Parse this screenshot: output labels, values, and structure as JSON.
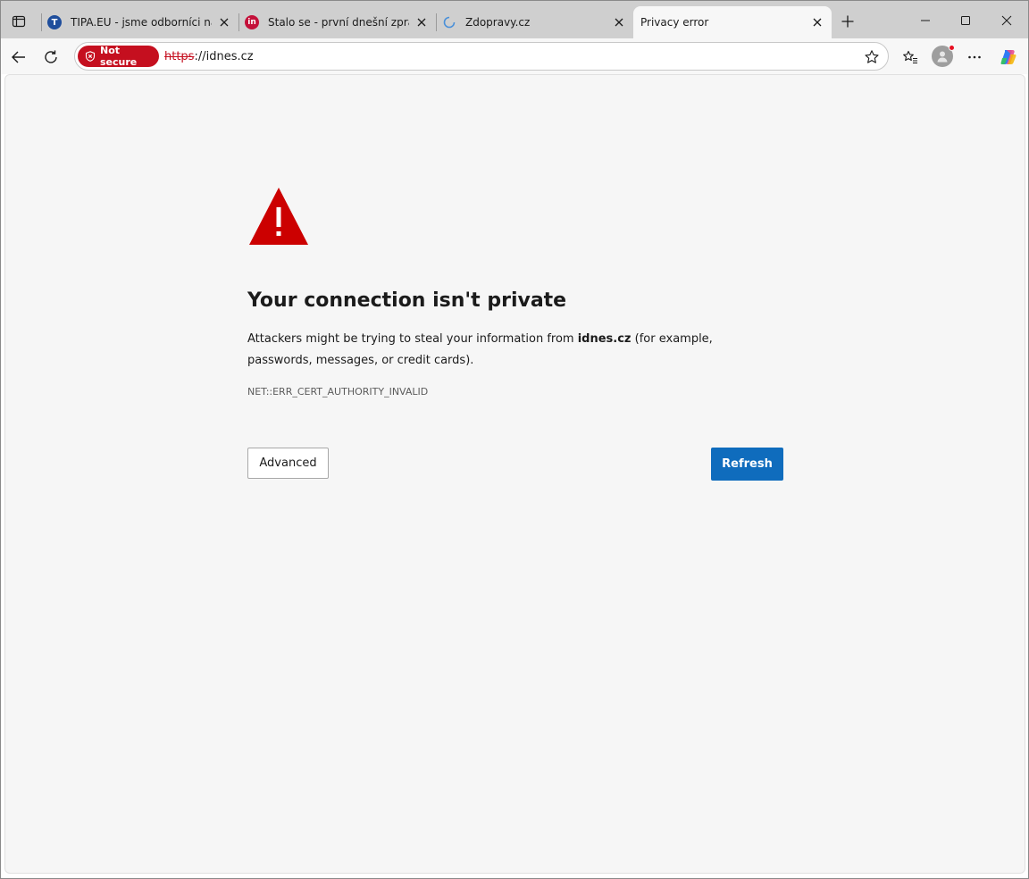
{
  "tabs": [
    {
      "title": "TIPA.EU - jsme odborníci na el",
      "favicon": "tipa-favicon",
      "favicon_letter": "T",
      "color": "#1f4e9c"
    },
    {
      "title": "Stalo se - první dnešní zprávy",
      "favicon": "idnes-favicon",
      "favicon_letter": "in",
      "color": "#c4113a"
    },
    {
      "title": "Zdopravy.cz",
      "favicon": "loading-favicon",
      "favicon_letter": "",
      "color": "#4a90d9"
    },
    {
      "title": "Privacy error",
      "favicon": "none",
      "favicon_letter": "",
      "color": ""
    }
  ],
  "toolbar": {
    "security_badge": "Not secure",
    "url_scheme": "https",
    "url_rest": "://idnes.cz"
  },
  "page": {
    "heading": "Your connection isn't private",
    "desc_before": "Attackers might be trying to steal your information from ",
    "desc_domain": "idnes.cz",
    "desc_after": " (for example, passwords, messages, or credit cards).",
    "error_code": "NET::ERR_CERT_AUTHORITY_INVALID",
    "advanced_label": "Advanced",
    "refresh_label": "Refresh"
  },
  "colors": {
    "warning": "#cc0000",
    "not_secure_badge": "#c50f1f",
    "primary_button": "#0f6cbd"
  }
}
